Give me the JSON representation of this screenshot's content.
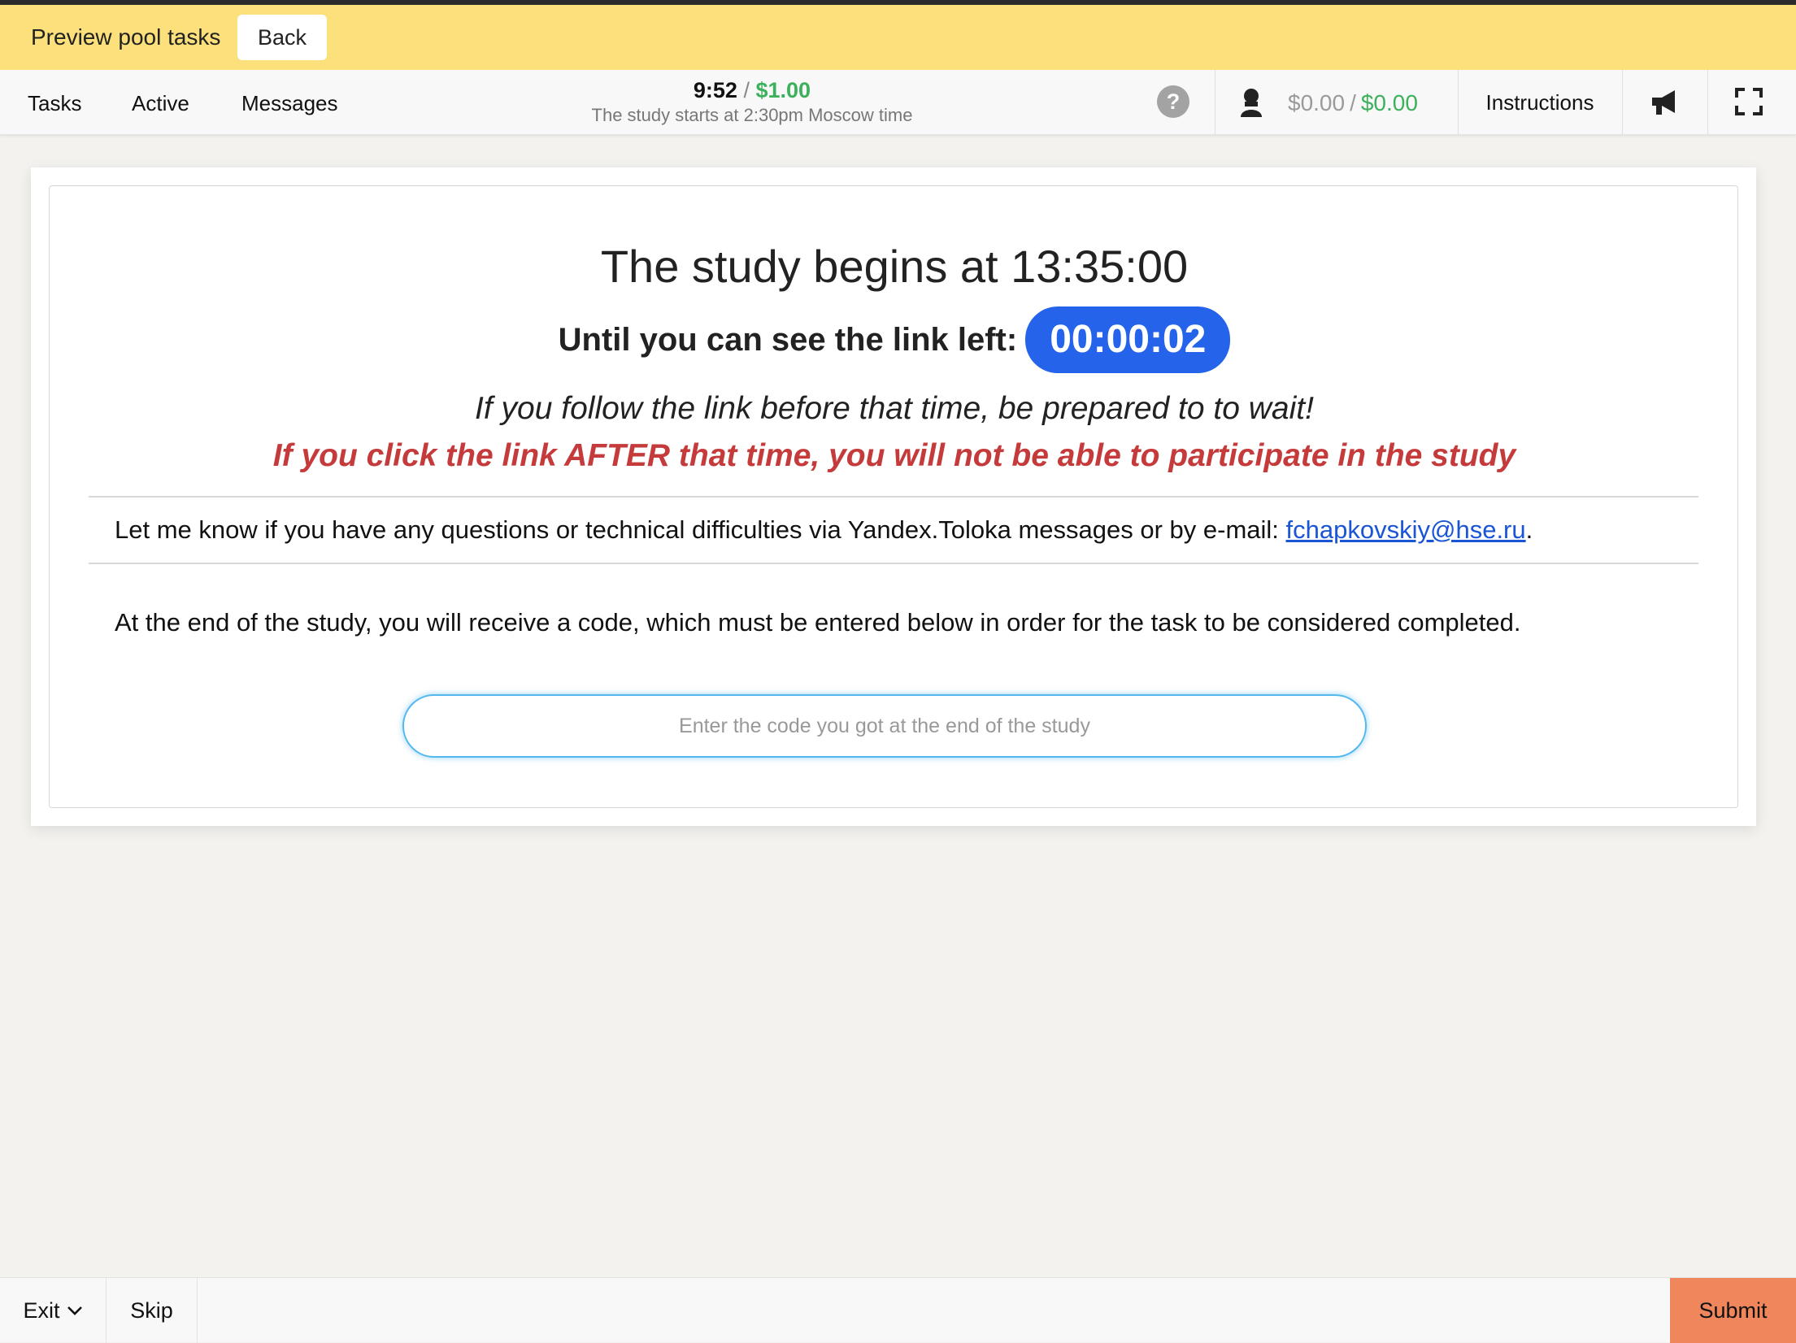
{
  "preview": {
    "title": "Preview pool tasks",
    "back_label": "Back"
  },
  "nav": {
    "tasks": "Tasks",
    "active": "Active",
    "messages": "Messages",
    "timer": "9:52",
    "timer_sep": "/",
    "price": "$1.00",
    "subtitle": "The study starts at 2:30pm Moscow time",
    "help": "?",
    "balance_left": "$0.00",
    "balance_sep": "/",
    "balance_right": "$0.00",
    "instructions": "Instructions",
    "icons": [
      "help-icon",
      "user-icon",
      "megaphone-icon",
      "fullscreen-icon"
    ]
  },
  "task": {
    "title": "The study begins at 13:35:00",
    "until_label": "Until you can see the link left:",
    "countdown": "00:00:02",
    "follow_note": "If you follow the link before that time, be prepared to to wait!",
    "warning": "If you click the link AFTER that time, you will not be able to participate in the study",
    "contact_text": "Let me know if you have any questions or technical difficulties via Yandex.Toloka messages or by e-mail: ",
    "contact_email": "fchapkovskiy@hse.ru",
    "contact_end": ".",
    "code_note": "At the end of the study, you will receive a code, which must be entered below in order for the task to be considered completed.",
    "code_placeholder": "Enter the code you got at the end of the study",
    "code_value": ""
  },
  "footer": {
    "exit": "Exit",
    "skip": "Skip",
    "submit": "Submit"
  },
  "colors": {
    "preview_bar": "#fce07b",
    "accent_green": "#3cb15b",
    "countdown_blue": "#2563eb",
    "warning_red": "#c53a3a",
    "link_blue": "#1a55d6",
    "submit_orange": "#f0875c"
  }
}
